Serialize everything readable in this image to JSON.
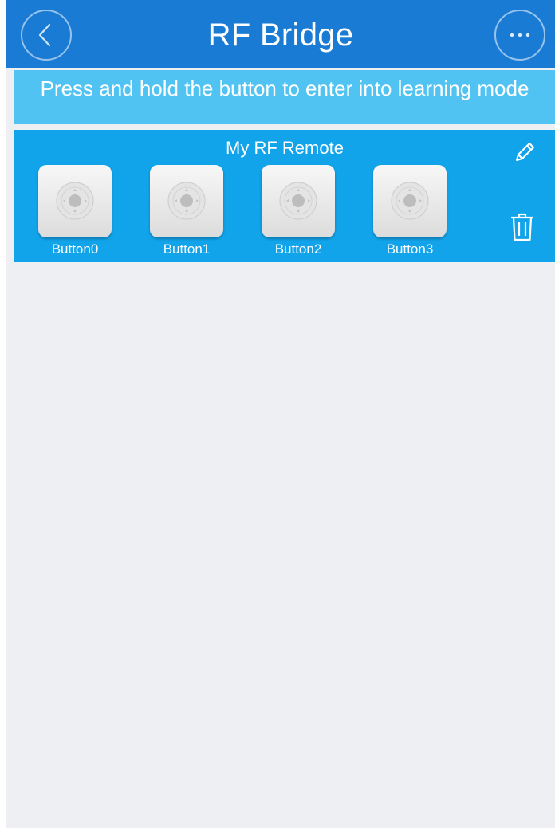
{
  "header": {
    "title": "RF Bridge",
    "back_icon": "chevron-left-icon",
    "more_icon": "more-dots-icon"
  },
  "banner": {
    "text": "Press and hold the button to enter into learning mode"
  },
  "remote": {
    "name": "My RF Remote",
    "edit_icon": "pencil-icon",
    "delete_icon": "trash-icon",
    "buttons": [
      {
        "label": "Button0"
      },
      {
        "label": "Button1"
      },
      {
        "label": "Button2"
      },
      {
        "label": "Button3"
      }
    ]
  },
  "colors": {
    "header": "#1a7bd4",
    "banner": "#51c3f2",
    "card": "#12a4ea",
    "background": "#edeff2"
  }
}
